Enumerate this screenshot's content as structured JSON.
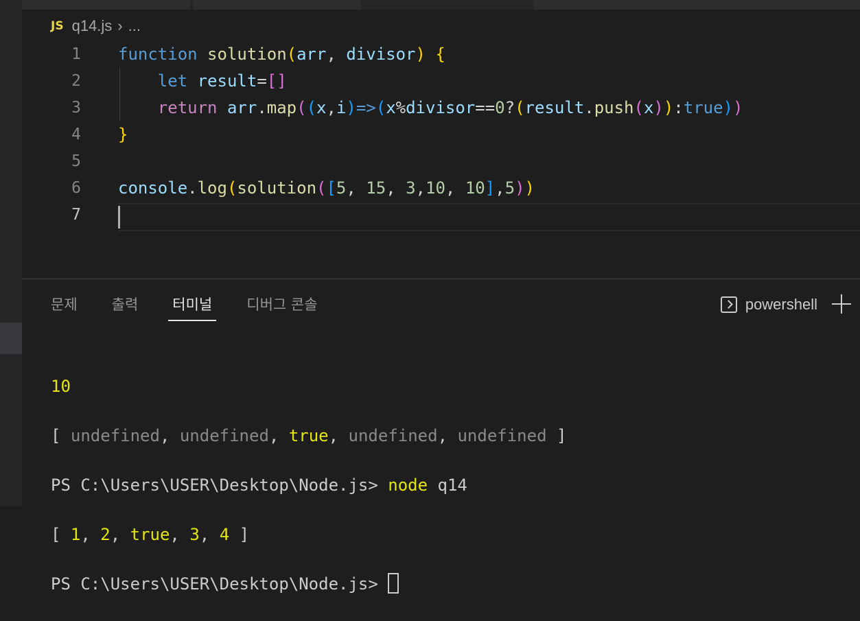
{
  "breadcrumb": {
    "file_icon": "JS",
    "file": "q14.js",
    "rest": "..."
  },
  "editor": {
    "line_numbers": [
      "1",
      "2",
      "3",
      "4",
      "5",
      "6",
      "7"
    ]
  },
  "panel": {
    "tabs": [
      "문제",
      "출력",
      "터미널",
      "디버그 콘솔"
    ],
    "active_tab": "터미널",
    "terminal_name": "powershell"
  },
  "terminal": {
    "lines": [
      "10",
      "[ undefined, undefined, true, undefined, undefined ]",
      "PS C:\\Users\\USER\\Desktop\\Node.js> node q14",
      "[ 1, 2, true, 3, 4 ]",
      "PS C:\\Users\\USER\\Desktop\\Node.js> "
    ]
  },
  "colors": {
    "background": "#1e1e1e",
    "keyword": "#569cd6",
    "function": "#dcdcaa",
    "string_yellow": "#e5e510"
  },
  "icons": [
    "js-file-icon",
    "chevron-right-icon",
    "terminal-icon",
    "plus-icon"
  ]
}
